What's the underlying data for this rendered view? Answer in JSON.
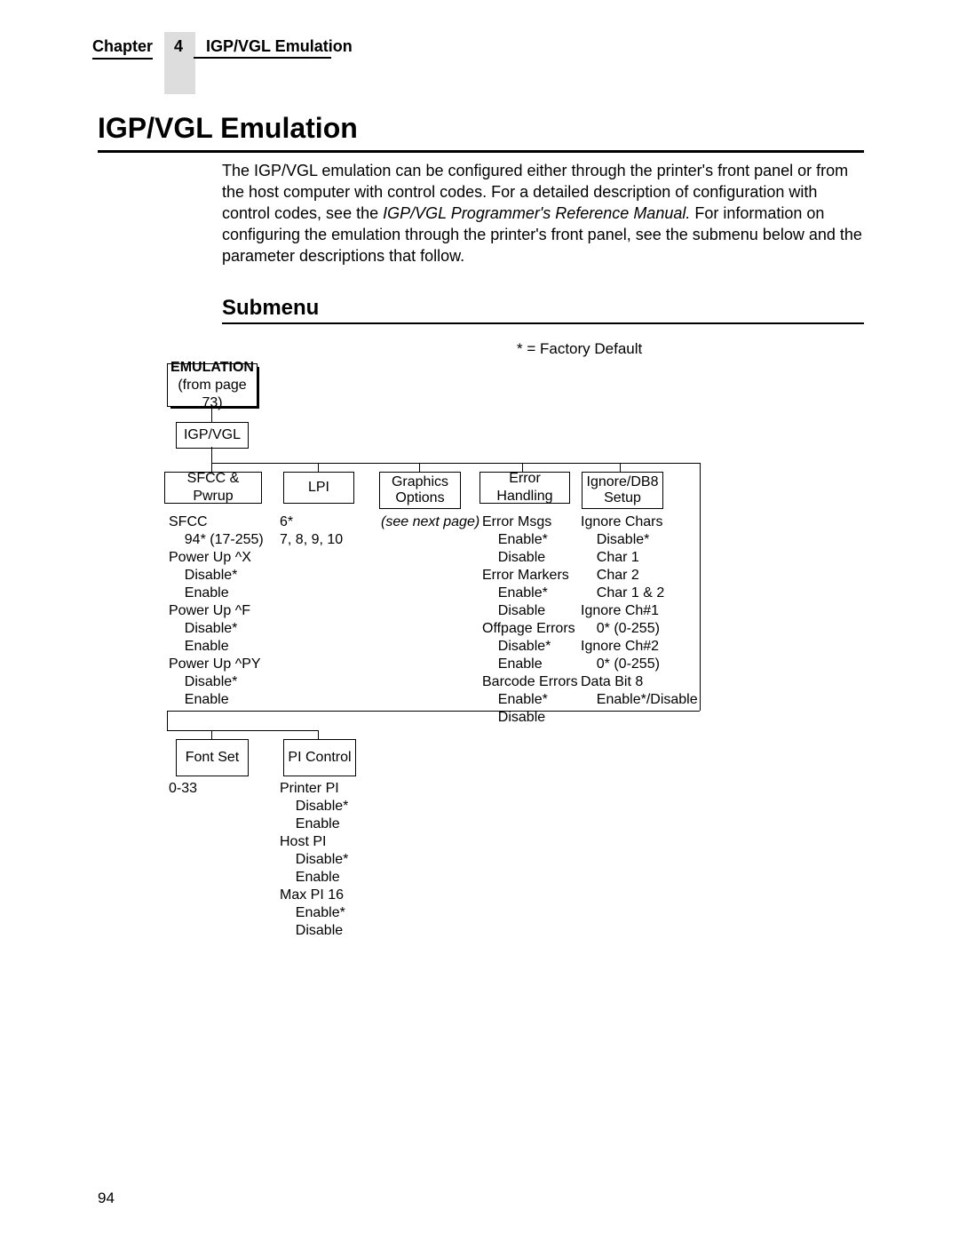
{
  "header": {
    "chapter_label": "Chapter",
    "chapter_num": "4",
    "title": "IGP/VGL Emulation"
  },
  "h1": "IGP/VGL Emulation",
  "intro": {
    "p1a": "The IGP/VGL emulation can be configured either through the printer's front panel or from the host computer with control codes. For a detailed description of configuration with control codes, see the ",
    "p1i": "IGP/VGL Programmer's Reference Manual.",
    "p1b": " For information on configuring the emulation through the printer's front panel, see the submenu below and the parameter descriptions that follow."
  },
  "h2": "Submenu",
  "legend": "* = Factory Default",
  "emul_box_title": "EMULATION",
  "emul_box_sub": "(from page 73)",
  "igp_vgl": "IGP/VGL",
  "row1": {
    "sfcc": "SFCC & Pwrup",
    "lpi": "LPI",
    "graphics1": "Graphics",
    "graphics2": "Options",
    "err": "Error Handling",
    "ign1": "Ignore/DB8",
    "ign2": "Setup"
  },
  "opt_sfcc": "SFCC\n    94* (17-255)\nPower Up ^X\n    Disable*\n    Enable\nPower Up ^F\n    Disable*\n    Enable\nPower Up ^PY\n    Disable*\n    Enable",
  "opt_lpi": "6*\n7, 8, 9, 10",
  "opt_graphics": "(see next page)",
  "opt_err": "Error Msgs\n    Enable*\n    Disable\nError Markers\n    Enable*\n    Disable\nOffpage Errors\n    Disable*\n    Enable\nBarcode Errors\n    Enable*\n    Disable",
  "opt_ign": "Ignore Chars\n    Disable*\n    Char 1\n    Char 2\n    Char 1 & 2\nIgnore Ch#1\n    0* (0-255)\nIgnore Ch#2\n    0* (0-255)\nData Bit 8\n    Enable*/Disable",
  "row2": {
    "fontset": "Font Set",
    "picontrol": "PI Control"
  },
  "opt_fontset": "0-33",
  "opt_pi": "Printer PI\n    Disable*\n    Enable\nHost PI\n    Disable*\n    Enable\nMax PI 16\n    Enable*\n    Disable",
  "pagenum": "94"
}
